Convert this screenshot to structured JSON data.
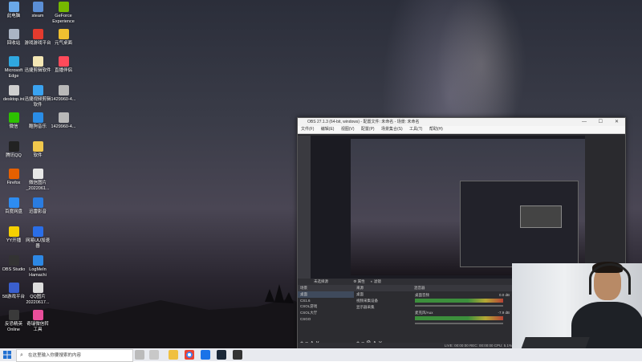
{
  "desktop": {
    "icons": [
      {
        "label": "此电脑",
        "icon": "computer-icon",
        "color": "#6aa8e8"
      },
      {
        "label": "steam",
        "icon": "steam-icon",
        "color": "#5b8fd6"
      },
      {
        "label": "GeForce Experience",
        "icon": "nvidia-icon",
        "color": "#76b900"
      },
      {
        "label": "回收站",
        "icon": "recycle-bin-icon",
        "color": "#aab4c4"
      },
      {
        "label": "游戏游戏平台",
        "icon": "game-platform-icon",
        "color": "#e33b2e"
      },
      {
        "label": "元气桌面",
        "icon": "yuanqi-icon",
        "color": "#f0c030"
      },
      {
        "label": "Microsoft Edge",
        "icon": "edge-icon",
        "color": "#2fa8e0"
      },
      {
        "label": "迅捷剪辑软件",
        "icon": "file-icon",
        "color": "#f4e7b5"
      },
      {
        "label": "直播伴侣",
        "icon": "live-companion-icon",
        "color": "#ff4a5a"
      },
      {
        "label": "desktop.ini",
        "icon": "ini-file-icon",
        "color": "#cfcfcf"
      },
      {
        "label": "迅捷视频剪辑软件",
        "icon": "video-editor-icon",
        "color": "#3aa3f0"
      },
      {
        "label": "1429960-4...",
        "icon": "image-file-icon",
        "color": "#b8b8b8"
      },
      {
        "label": "微信",
        "icon": "wechat-icon",
        "color": "#2dc100"
      },
      {
        "label": "酷狗音乐",
        "icon": "kugou-icon",
        "color": "#2a8de6"
      },
      {
        "label": "1429960-4...",
        "icon": "image-file-icon",
        "color": "#b8b8b8"
      },
      {
        "label": "腾讯QQ",
        "icon": "qq-icon",
        "color": "#222"
      },
      {
        "label": "软件",
        "icon": "folder-icon",
        "color": "#f1c84c"
      },
      {
        "label": "Firefox",
        "icon": "firefox-icon",
        "color": "#e66000"
      },
      {
        "label": "微信图片 _2022061...",
        "icon": "image-file-icon",
        "color": "#e8e8e8"
      },
      {
        "label": "百度网盘",
        "icon": "baidu-netdisk-icon",
        "color": "#2e8cf0"
      },
      {
        "label": "迅雷影音",
        "icon": "xunlei-icon",
        "color": "#2a7ce0"
      },
      {
        "label": "YY开播",
        "icon": "yy-icon",
        "color": "#f5d000"
      },
      {
        "label": "网易UU加速器",
        "icon": "uu-icon",
        "color": "#2a6ee8"
      },
      {
        "label": "OBS Studio",
        "icon": "obs-icon",
        "color": "#333"
      },
      {
        "label": "LogMeIn Hamachi",
        "icon": "hamachi-icon",
        "color": "#2d88e5"
      },
      {
        "label": "58游戏平台",
        "icon": "58-game-icon",
        "color": "#3a5fcd"
      },
      {
        "label": "QQ图片 20220617...",
        "icon": "image-file-icon",
        "color": "#ddd"
      },
      {
        "label": "反恐精英 Online",
        "icon": "cso-icon",
        "color": "#3a3a3a"
      },
      {
        "label": "奇瑞微信转 工具",
        "icon": "tool-icon",
        "color": "#e84e9a"
      }
    ]
  },
  "obs": {
    "title": "OBS 27.1.3 (64-bit, windows) - 配置文件: 未命名 - 场景: 未命名",
    "menu": [
      "文件(F)",
      "编辑(E)",
      "视图(V)",
      "配置(P)",
      "场景集合(S)",
      "工具(T)",
      "帮助(H)"
    ],
    "window_controls": {
      "min": "—",
      "max": "☐",
      "close": "✕"
    },
    "scene_label": "未选择源",
    "properties_btn": "属性",
    "filters_btn": "滤镜",
    "docks": {
      "scenes": {
        "title": "场景",
        "items": [
          "桌面",
          "CS1.6",
          "CSOL游戏",
          "CSOL大厅",
          "CSGO"
        ]
      },
      "sources": {
        "title": "来源",
        "items": [
          "桌面",
          "视频采集设备",
          "显示器采集"
        ]
      },
      "mixer": {
        "title": "混音器",
        "tracks": [
          "桌面音频",
          "麦克风/Aux"
        ],
        "levels_db": [
          "0.0 dB",
          "-7.9 dB"
        ]
      }
    },
    "status": "LIVE: 00:00:00   REC: 00:00:00   CPU: 5.1%, 30.00 fps"
  },
  "taskbar": {
    "search_placeholder": "在这里输入你要搜索的内容",
    "icons": [
      "task-view-icon",
      "file-explorer-icon",
      "chrome-icon",
      "bluetooth-app-icon",
      "steam-icon",
      "runner-icon",
      "obs-icon"
    ]
  }
}
